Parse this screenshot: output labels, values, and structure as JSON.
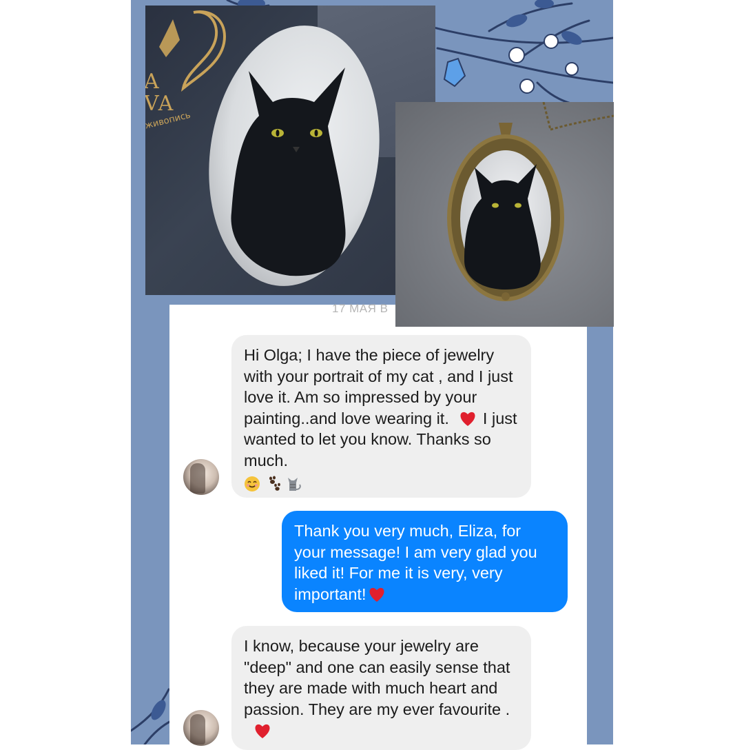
{
  "photo1": {
    "logo_text": "A\nVA",
    "logo_sub": "живопись"
  },
  "date_stamp": "17 МАЯ В",
  "messages": [
    {
      "direction": "incoming",
      "text": "Hi Olga;  I have the piece of jewelry with your portrait of my cat , and I just love it.  Am so impressed by your painting..and love wearing it.",
      "text_after_heart": "I just wanted to let you know.   Thanks so much.",
      "emojis": [
        "smiling-face",
        "paw-prints",
        "cat"
      ]
    },
    {
      "direction": "outgoing",
      "text": "Thank you very much, Eliza, for your message! I am very glad you liked it! For me it is very, very important!"
    },
    {
      "direction": "incoming",
      "text": "I know, because your jewelry are \"deep\" and one can easily sense that they are made with much heart and passion.  They are my ever favourite ."
    }
  ],
  "colors": {
    "panel": "#7a95bd",
    "incoming_bubble": "#efefef",
    "outgoing_bubble": "#0a84ff",
    "heart": "#e0202e"
  }
}
